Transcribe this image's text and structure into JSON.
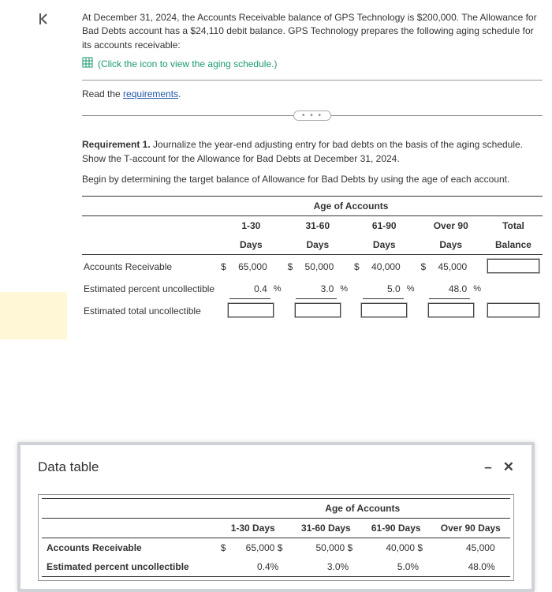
{
  "intro": "At December 31, 2024, the Accounts Receivable balance of GPS Technology is $200,000. The Allowance for Bad Debts account has a $24,110 debit balance. GPS Technology prepares the following aging schedule for its accounts receivable:",
  "icon_link": "(Click the icon to view the aging schedule.)",
  "read_prefix": "Read the ",
  "read_link": "requirements",
  "read_suffix": ".",
  "ellipsis": "• • •",
  "req1_bold": "Requirement 1.",
  "req1_text": " Journalize the year-end adjusting entry for bad debts on the basis of the aging schedule. Show the T-account for the Allowance for Bad Debts at December 31, 2024.",
  "instruction": "Begin by determining the target balance of Allowance for Bad Debts by using the age of each account.",
  "table": {
    "super_header": "Age of Accounts",
    "cols": {
      "c1a": "1-30",
      "c1b": "Days",
      "c2a": "31-60",
      "c2b": "Days",
      "c3a": "61-90",
      "c3b": "Days",
      "c4a": "Over 90",
      "c4b": "Days",
      "c5a": "Total",
      "c5b": "Balance"
    },
    "rows": {
      "ar_label": "Accounts Receivable",
      "ar": {
        "v1": "65,000",
        "v2": "50,000",
        "v3": "40,000",
        "v4": "45,000"
      },
      "pct_label": "Estimated percent uncollectible",
      "pct": {
        "v1": "0.4",
        "v2": "3.0",
        "v3": "5.0",
        "v4": "48.0"
      },
      "tot_label": "Estimated total uncollectible"
    }
  },
  "modal": {
    "title": "Data table",
    "super_header": "Age of Accounts",
    "cols": {
      "c1": "1-30 Days",
      "c2": "31-60 Days",
      "c3": "61-90 Days",
      "c4": "Over 90 Days"
    },
    "rows": {
      "ar_label": "Accounts Receivable",
      "ar": {
        "v1": "65,000",
        "v2": "50,000",
        "v3": "40,000",
        "v4": "45,000"
      },
      "pct_label": "Estimated percent uncollectible",
      "pct": {
        "v1": "0.4%",
        "v2": "3.0%",
        "v3": "5.0%",
        "v4": "48.0%"
      }
    }
  },
  "sym": {
    "dollar": "$",
    "pct": "%",
    "minimize": "–",
    "close": "✕"
  }
}
